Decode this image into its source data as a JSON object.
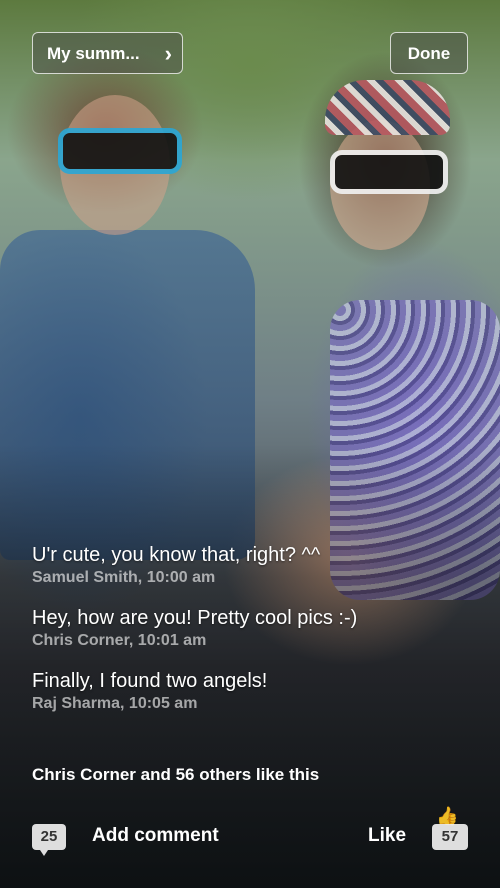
{
  "header": {
    "album_label": "My summ...",
    "chevron_icon": "chevron-right-icon",
    "done_label": "Done"
  },
  "comments": [
    {
      "text": "U'r cute, you know that, right? ^^",
      "author_time": "Samuel Smith, 10:00 am"
    },
    {
      "text": "Hey, how are you! Pretty cool pics :-)",
      "author_time": "Chris Corner, 10:01 am"
    },
    {
      "text": "Finally, I found two angels!",
      "author_time": "Raj Sharma, 10:05 am"
    }
  ],
  "likes_summary": "Chris Corner and 56 others like this",
  "footer": {
    "comment_count": "25",
    "add_comment_label": "Add comment",
    "like_label": "Like",
    "like_count": "57",
    "comment_icon": "speech-bubble-icon",
    "like_icon": "thumbs-up-icon"
  }
}
